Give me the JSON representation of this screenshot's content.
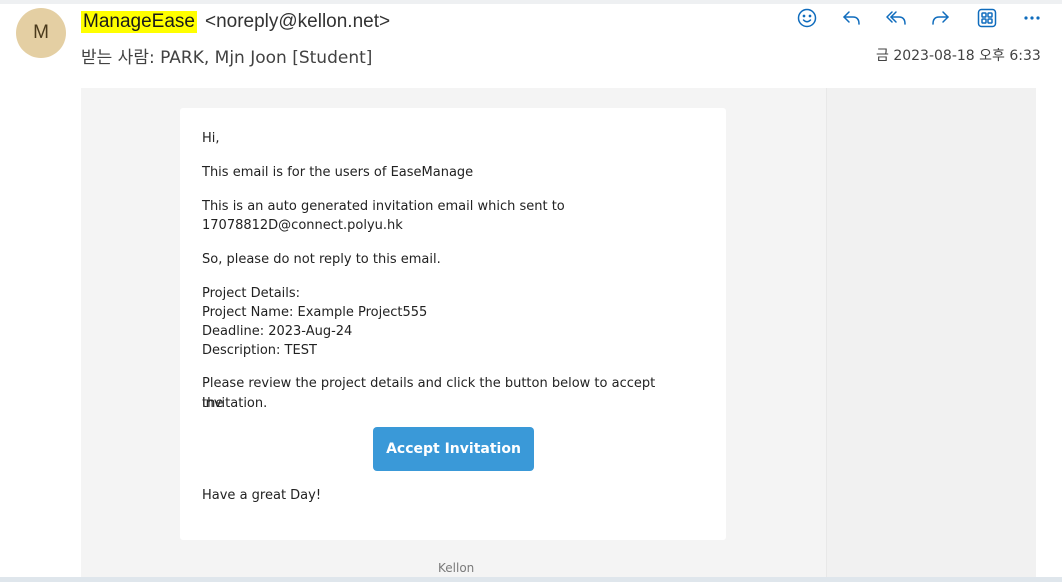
{
  "sender": {
    "initial": "M",
    "name": "ManageEase",
    "email": "<noreply@kellon.net>"
  },
  "recipient_line": "받는 사람:  PARK, Mjn Joon [Student]",
  "date": "금 2023-08-18 오후 6:33",
  "actions": [
    {
      "icon": "emoji-icon"
    },
    {
      "icon": "reply-icon"
    },
    {
      "icon": "reply-all-icon"
    },
    {
      "icon": "forward-icon"
    },
    {
      "icon": "apps-icon"
    },
    {
      "icon": "more-icon"
    }
  ],
  "colors": {
    "accent": "#0f6cbd",
    "button": "#3a99d8",
    "highlight": "#ffff00",
    "avatar": "#e4cfa3"
  },
  "message": {
    "greeting": "Hi,",
    "line1": "This email is for the users of EaseManage",
    "line2a": "This is an auto generated invitation email which sent to",
    "line2b": "17078812D@connect.polyu.hk",
    "line3": "So, please do not reply to this email.",
    "details_header": "Project Details:",
    "project_name": "Project Name: Example Project555",
    "deadline": "Deadline: 2023-Aug-24",
    "description": "Description: TEST",
    "instruction_a": "Please review the project details and click the button below to accept the",
    "instruction_b": "invitation.",
    "button_label": "Accept Invitation",
    "closing": "Have a great Day!"
  },
  "footer": "Kellon"
}
